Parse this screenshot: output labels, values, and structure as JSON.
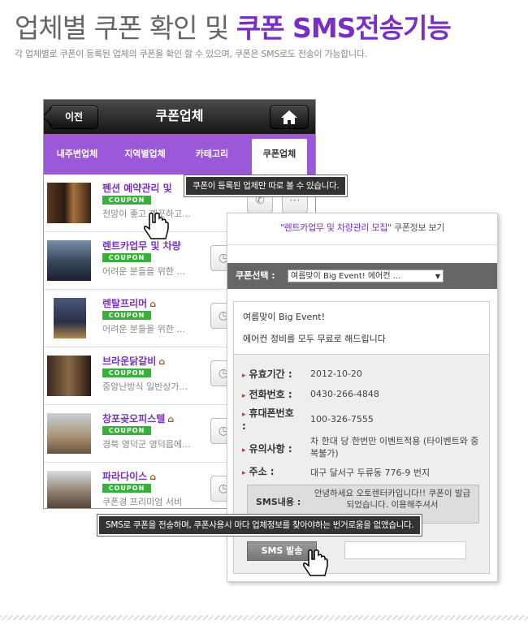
{
  "heading": {
    "plain": "업체별 쿠폰 확인 및 ",
    "accent": "쿠폰 SMS전송기능"
  },
  "subheading": "각 업체별로 쿠폰이 등록된 업체의 쿠폰을 확인 할 수 있으며, 쿠폰은 SMS로도 전송이 가능합니다.",
  "phone": {
    "back_label": "이전",
    "title": "쿠폰업체",
    "tabs": [
      "내주변업체",
      "지역별업체",
      "카테고리",
      "쿠폰업체"
    ],
    "coupon_badge": "COUPON",
    "rows": [
      {
        "name": "펜션 예약관리 및",
        "desc": "전망이 좋고 깨끗하고..."
      },
      {
        "name": "렌트카업무 및 차량",
        "desc": "어려운 분들을 위한 ..."
      },
      {
        "name": "렌탈프리머",
        "desc": "어려운 분들을 위한 ..."
      },
      {
        "name": "브라운닭갈비",
        "desc": "중앙난방식 일반상가..."
      },
      {
        "name": "창포곶오피스텔",
        "desc": "경북 영덕군 영덕읍에..."
      },
      {
        "name": "파라다이스",
        "desc": "쿠폰경 프리미엄 서비"
      }
    ]
  },
  "tooltips": {
    "top": "쿠폰이 등록된 업체만 따로 볼 수 있습니다.",
    "bottom": "SMS로 쿠폰을 전송하며, 쿠폰사용시 마다 업체정보를 찾아야하는 번거로움을 없앴습니다."
  },
  "popup": {
    "header_quote": "\"렌트카업무 및 차량관리 모집\"",
    "header_suffix": " 쿠폰정보 보기",
    "select_label": "쿠폰선택 :",
    "select_value": "여름맞이 Big Event! 에어컨 ...",
    "message_line1": "여름맞이 Big Event!",
    "message_line2": "에어컨 정비를 모두 무료로 해드립니다",
    "fields": [
      {
        "label": "유효기간 :",
        "value": "2012-10-20"
      },
      {
        "label": "전화번호 :",
        "value": "0430-266-4848"
      },
      {
        "label": "휴대폰번호 :",
        "value": "100-326-7555"
      },
      {
        "label": "유의사항 :",
        "value": "차 한대 당 한번만 이벤트적용 (타이벤트와 중복불가)"
      },
      {
        "label": "주소 :",
        "value": "대구 달서구 두류동 776-9 번지"
      }
    ],
    "sms_label": "SMS내용 :",
    "sms_text": "안녕하세요 오토렌터카입니다!! 쿠폰이 발급되었습니다. 이용해주셔서",
    "sms_button": "SMS 발송"
  },
  "colors": {
    "accent": "#7a2fc4",
    "tab_bar": "#9b59d9",
    "coupon": "#3ab03a"
  }
}
